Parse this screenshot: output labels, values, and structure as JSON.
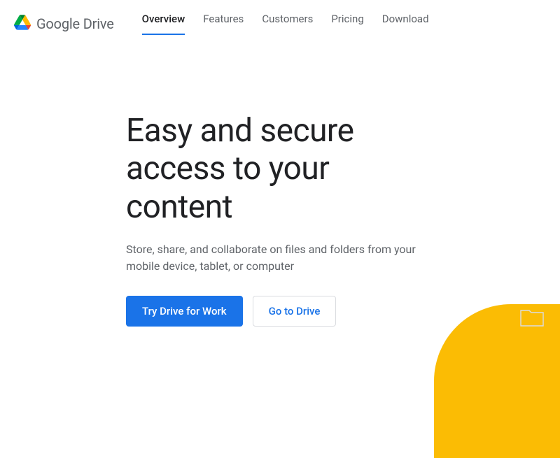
{
  "brand": {
    "name": "Google Drive"
  },
  "nav": {
    "items": [
      {
        "label": "Overview",
        "active": true
      },
      {
        "label": "Features",
        "active": false
      },
      {
        "label": "Customers",
        "active": false
      },
      {
        "label": "Pricing",
        "active": false
      },
      {
        "label": "Download",
        "active": false
      }
    ]
  },
  "hero": {
    "title": "Easy and secure access to your content",
    "subtitle": "Store, share, and collaborate on files and folders from your mobile device, tablet, or computer",
    "cta_primary": "Try Drive for Work",
    "cta_secondary": "Go to Drive"
  },
  "colors": {
    "accent": "#1a73e8",
    "yellow": "#fbbc04"
  }
}
